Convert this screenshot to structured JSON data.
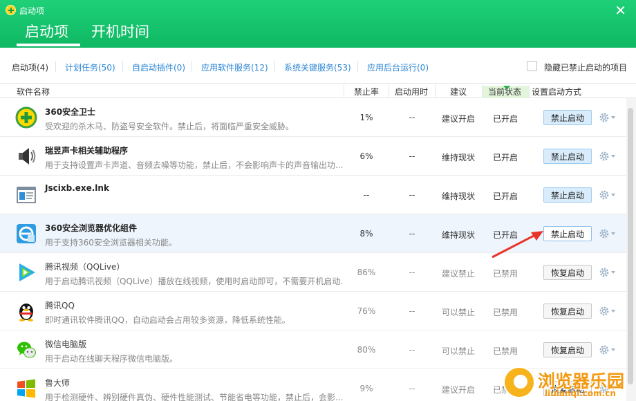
{
  "window": {
    "title": "启动项",
    "close_glyph": "✕"
  },
  "main_tabs": [
    {
      "label": "启动项",
      "active": true
    },
    {
      "label": "开机时间",
      "active": false
    }
  ],
  "sub_tabs": [
    {
      "label": "启动项(4)"
    },
    {
      "label": "计划任务(50)"
    },
    {
      "label": "自启动插件(0)"
    },
    {
      "label": "应用软件服务(12)"
    },
    {
      "label": "系统关键服务(53)"
    },
    {
      "label": "应用后台运行(0)"
    }
  ],
  "hide_disabled": {
    "label": "隐藏已禁止启动的项目",
    "checked": false
  },
  "columns": {
    "name": "软件名称",
    "rate": "禁止率",
    "time": "启动用时",
    "suggest": "建议",
    "state": "当前状态",
    "action": "设置启动方式"
  },
  "rows": [
    {
      "name": "360安全卫士",
      "desc": "受欢迎的杀木马、防盗号安全软件。禁止后，将面临严重安全威胁。",
      "rate": "1%",
      "time": "--",
      "suggest": "建议开启",
      "state": "已开启",
      "action": "禁止启动",
      "icon": "360-safe-icon"
    },
    {
      "name": "瑞昱声卡相关辅助程序",
      "desc": "用于支持设置声卡声道、音频去噪等功能，禁止后，不会影响声卡的声音输出功...",
      "rate": "6%",
      "time": "--",
      "suggest": "维持现状",
      "state": "已开启",
      "action": "禁止启动",
      "icon": "speaker-icon"
    },
    {
      "name": "Jscixb.exe.lnk",
      "desc": "",
      "rate": "--",
      "time": "--",
      "suggest": "维持现状",
      "state": "已开启",
      "action": "禁止启动",
      "icon": "program-window-icon"
    },
    {
      "name": "360安全浏览器优化组件",
      "desc": "用于支持360安全浏览器相关功能。",
      "rate": "8%",
      "time": "--",
      "suggest": "维持现状",
      "state": "已开启",
      "action": "禁止启动",
      "icon": "360-browser-icon"
    },
    {
      "name": "腾讯视频（QQLive）",
      "desc": "用于启动腾讯视频（QQLive）播放在线视频，使用时启动即可，不需要开机启动...",
      "rate": "86%",
      "time": "--",
      "suggest": "建议禁止",
      "state": "已禁用",
      "action": "恢复启动",
      "icon": "tencent-video-icon"
    },
    {
      "name": "腾讯QQ",
      "desc": "即时通讯软件腾讯QQ，自动启动会占用较多资源，降低系统性能。",
      "rate": "76%",
      "time": "--",
      "suggest": "可以禁止",
      "state": "已禁用",
      "action": "恢复启动",
      "icon": "qq-penguin-icon"
    },
    {
      "name": "微信电脑版",
      "desc": "用于启动在线聊天程序微信电脑版。",
      "rate": "80%",
      "time": "--",
      "suggest": "可以禁止",
      "state": "已禁用",
      "action": "恢复启动",
      "icon": "wechat-icon"
    },
    {
      "name": "鲁大师",
      "desc": "用于检测硬件、辨别硬件真伪、硬件性能测试、节能省电等功能，禁止后，会影...",
      "rate": "9%",
      "time": "--",
      "suggest": "建议开启",
      "state": "已禁用",
      "action": "恢复启动",
      "icon": "windows-logo-icon"
    }
  ],
  "watermark": {
    "title": "浏览器乐园",
    "url": "liulanqi.com.cn"
  },
  "colors": {
    "accent_green": "#13c16b",
    "link_blue": "#2a85d4",
    "highlight_row": "#eef5fc",
    "arrow_red": "#e8352a"
  }
}
